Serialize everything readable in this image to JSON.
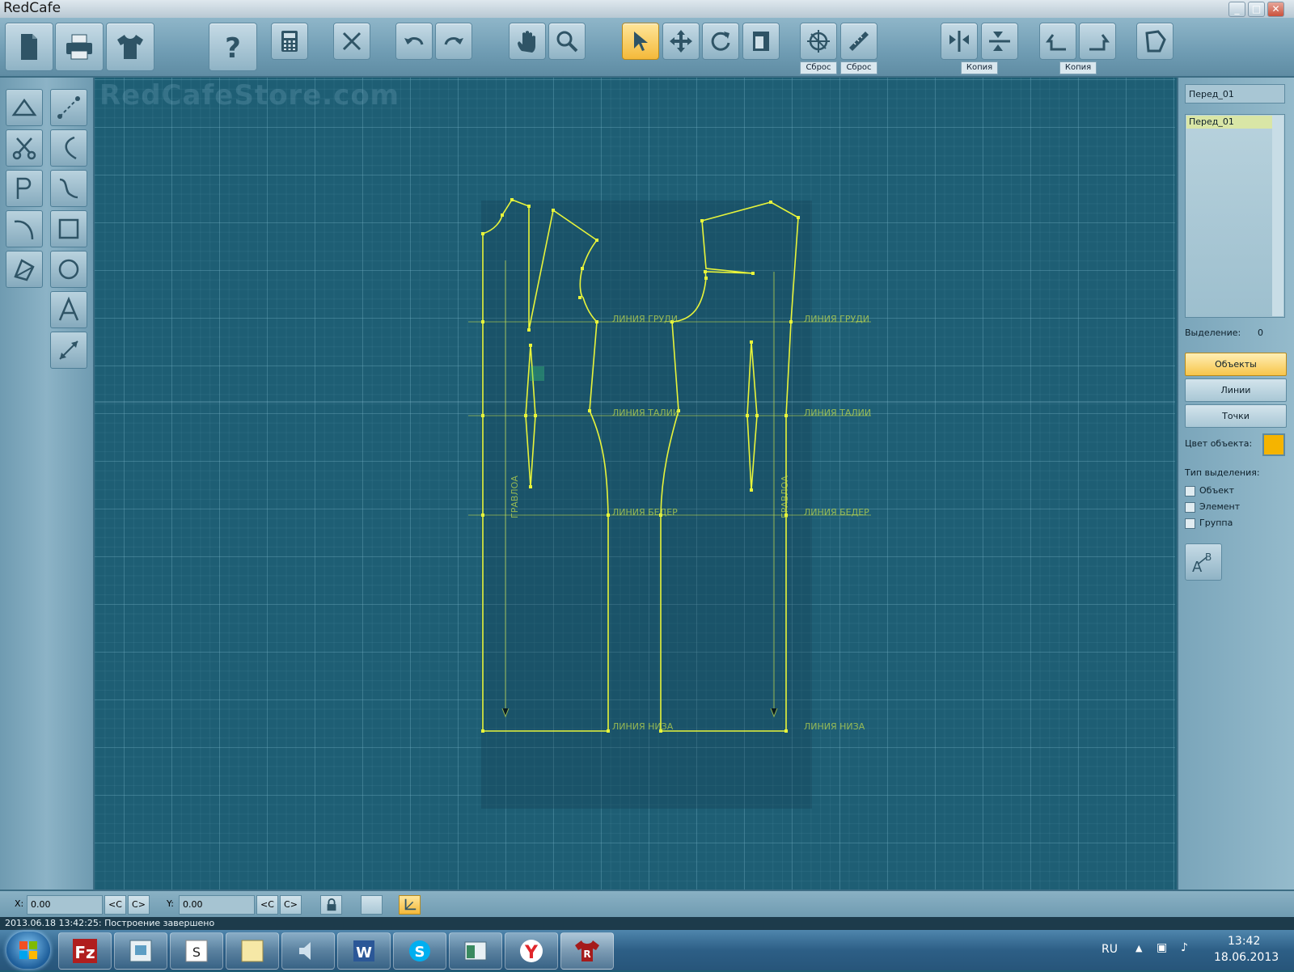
{
  "window": {
    "title": "RedCafe",
    "controls": {
      "minimize": "_",
      "maximize": "□",
      "close": "✕"
    }
  },
  "toolbar": {
    "buttons": [
      {
        "name": "new-document",
        "icon": "document-icon"
      },
      {
        "name": "print",
        "icon": "printer-icon"
      },
      {
        "name": "shirt",
        "icon": "shirt-icon"
      },
      {
        "name": "help",
        "icon": "question-icon"
      },
      {
        "name": "calculator",
        "icon": "calculator-icon"
      },
      {
        "name": "delete",
        "icon": "x-icon"
      },
      {
        "name": "undo",
        "icon": "undo-icon"
      },
      {
        "name": "redo",
        "icon": "redo-icon"
      },
      {
        "name": "pan",
        "icon": "hand-icon"
      },
      {
        "name": "zoom",
        "icon": "magnifier-icon"
      },
      {
        "name": "select",
        "icon": "cursor-icon",
        "active": true
      },
      {
        "name": "move",
        "icon": "move-icon"
      },
      {
        "name": "rotate",
        "icon": "rotate-icon"
      },
      {
        "name": "scale",
        "icon": "scale-icon"
      },
      {
        "name": "reset-compass",
        "icon": "compass-icon",
        "label": "Сброс"
      },
      {
        "name": "reset-ruler",
        "icon": "ruler-icon",
        "label": "Сброс"
      },
      {
        "name": "mirror-vertical",
        "icon": "mirror-vertical-icon"
      },
      {
        "name": "mirror-horizontal",
        "icon": "mirror-horizontal-icon",
        "label": "Копия"
      },
      {
        "name": "rotate-left-copy",
        "icon": "rotate-left-icon"
      },
      {
        "name": "rotate-right-copy",
        "icon": "rotate-right-icon",
        "label": "Копия"
      },
      {
        "name": "polygon",
        "icon": "polygon-icon"
      }
    ]
  },
  "left_tools": [
    {
      "name": "triangle-tool",
      "icon": "triangle-icon"
    },
    {
      "name": "line-tool",
      "icon": "dotted-line-icon"
    },
    {
      "name": "cut-tool",
      "icon": "scissors-icon"
    },
    {
      "name": "angle-tool",
      "icon": "angle-icon"
    },
    {
      "name": "p-tool",
      "icon": "p-curve-icon"
    },
    {
      "name": "curve-tool",
      "icon": "s-curve-icon"
    },
    {
      "name": "arc-tool",
      "icon": "arc-icon"
    },
    {
      "name": "rectangle-tool",
      "icon": "square-icon"
    },
    {
      "name": "dart-tool",
      "icon": "dart-icon"
    },
    {
      "name": "circle-tool",
      "icon": "circle-icon"
    },
    {
      "name": "text-tool",
      "icon": "letter-a-icon"
    },
    {
      "name": "measure-tool",
      "icon": "measure-icon"
    }
  ],
  "canvas": {
    "watermark": "RedCafeStore.com",
    "pattern_labels": [
      "ЛИНИЯ ГРУДИ",
      "ЛИНИЯ ГРУДИ",
      "ЛИНИЯ ТАЛИИ",
      "ЛИНИЯ ТАЛИИ",
      "ЛИНИЯ БЕДЕР",
      "ЛИНИЯ БЕДЕР",
      "ЛИНИЯ НИЗА",
      "ЛИНИЯ НИЗА",
      "ГРАВЛОА",
      "ГРАВЛОА"
    ],
    "pattern_color": "#e8f43a"
  },
  "right_panel": {
    "name_field": "Перед_01",
    "list_items": [
      "Перед_01"
    ],
    "selection_label": "Выделение:",
    "selection_count": "0",
    "buttons": [
      "Объекты",
      "Линии",
      "Точки"
    ],
    "active_button": "Объекты",
    "object_color_label": "Цвет объекта:",
    "object_color": "#f5b400",
    "selection_type_label": "Тип выделения:",
    "selection_types": [
      "Объект",
      "Элемент",
      "Группа"
    ]
  },
  "coords": {
    "x_label": "X:",
    "x_value": "0.00",
    "y_label": "Y:",
    "y_value": "0.00",
    "prev_label": "<C",
    "next_label": "C>"
  },
  "status": "2013.06.18 13:42:25: Построение завершено",
  "taskbar": {
    "apps": [
      "filezilla",
      "explorer",
      "skype-s",
      "notes",
      "speaker",
      "word",
      "skype",
      "window",
      "yandex",
      "redcafe"
    ],
    "lang": "RU",
    "time": "13:42",
    "date": "18.06.2013"
  }
}
